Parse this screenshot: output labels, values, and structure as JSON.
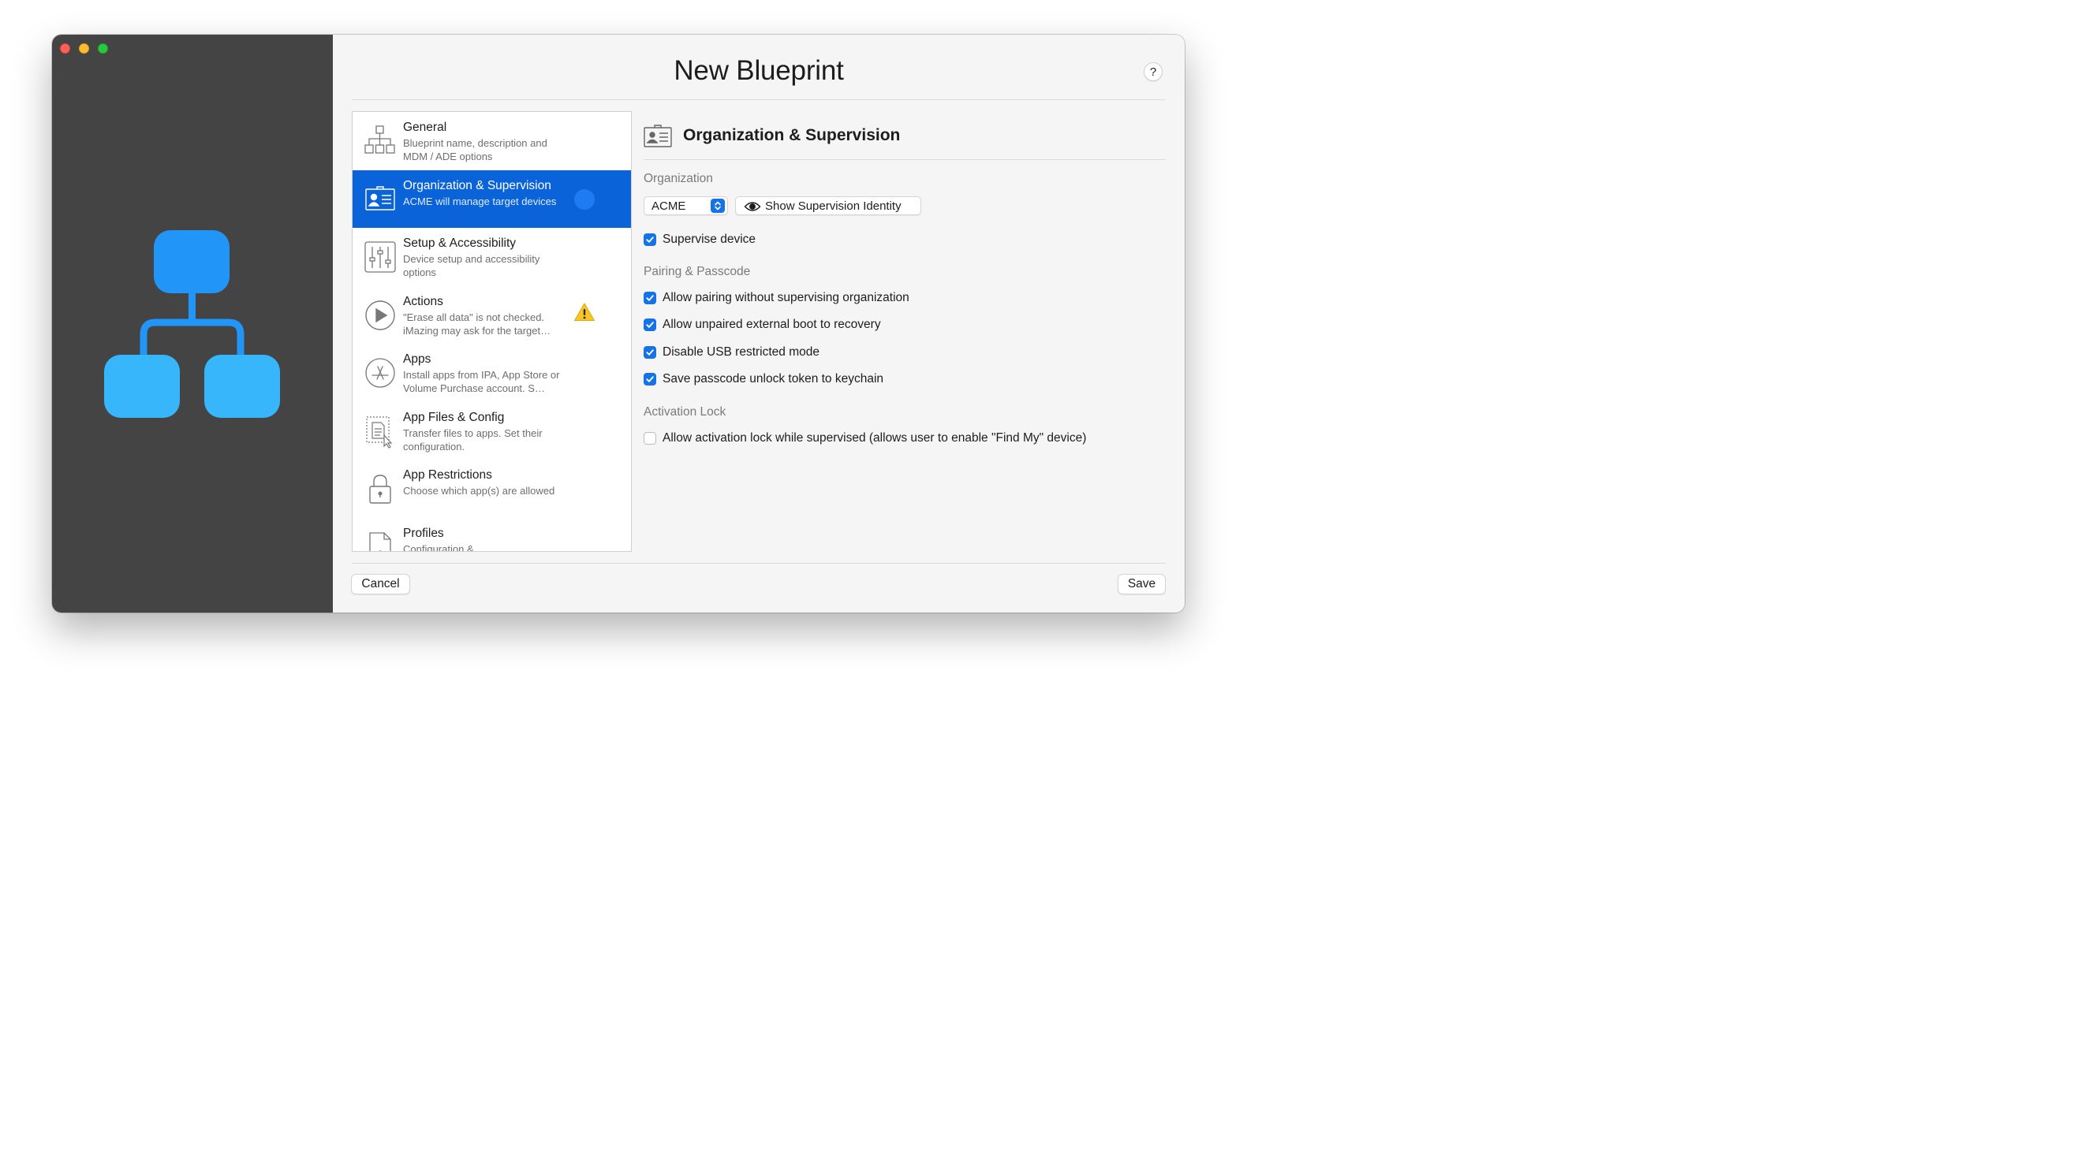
{
  "window": {
    "title": "New Blueprint",
    "help_label": "?"
  },
  "sidebar": {
    "items": [
      {
        "title": "General",
        "subtitle": "Blueprint name, description and MDM / ADE options",
        "icon": "hierarchy-icon"
      },
      {
        "title": "Organization & Supervision",
        "subtitle": "ACME will manage target devices",
        "icon": "id-card-icon",
        "selected": true
      },
      {
        "title": "Setup & Accessibility",
        "subtitle": "Device setup and accessibility options",
        "icon": "sliders-icon"
      },
      {
        "title": "Actions",
        "subtitle": "\"Erase all data\" is not checked. iMazing may ask for the target…",
        "icon": "play-icon",
        "warning": true
      },
      {
        "title": "Apps",
        "subtitle": "Install apps from IPA, App Store or Volume Purchase account. S…",
        "icon": "app-store-icon"
      },
      {
        "title": "App Files & Config",
        "subtitle": "Transfer files to apps. Set their configuration.",
        "icon": "file-config-icon"
      },
      {
        "title": "App Restrictions",
        "subtitle": "Choose which app(s) are allowed",
        "icon": "lock-icon"
      },
      {
        "title": "Profiles",
        "subtitle": "Configuration &",
        "icon": "profile-gear-icon"
      }
    ]
  },
  "detail": {
    "section_title": "Organization & Supervision",
    "organization_label": "Organization",
    "organization_value": "ACME",
    "show_identity_label": "Show Supervision Identity",
    "supervise_label": "Supervise device",
    "supervise_checked": true,
    "pairing_label": "Pairing & Passcode",
    "pairing_options": [
      {
        "label": "Allow pairing without supervising organization",
        "checked": true
      },
      {
        "label": "Allow unpaired external boot to recovery",
        "checked": true
      },
      {
        "label": "Disable USB restricted mode",
        "checked": true
      },
      {
        "label": "Save passcode unlock token to keychain",
        "checked": true
      }
    ],
    "activation_label": "Activation Lock",
    "activation_option": {
      "label": "Allow activation lock while supervised (allows user to enable \"Find My\" device)",
      "checked": false
    }
  },
  "footer": {
    "cancel_label": "Cancel",
    "save_label": "Save"
  },
  "colors": {
    "accent": "#0a63d9",
    "left_pane": "#444444",
    "hero_top": "#2196f8",
    "hero_bottom": "#38b6fb",
    "warning": "#f7c325"
  }
}
